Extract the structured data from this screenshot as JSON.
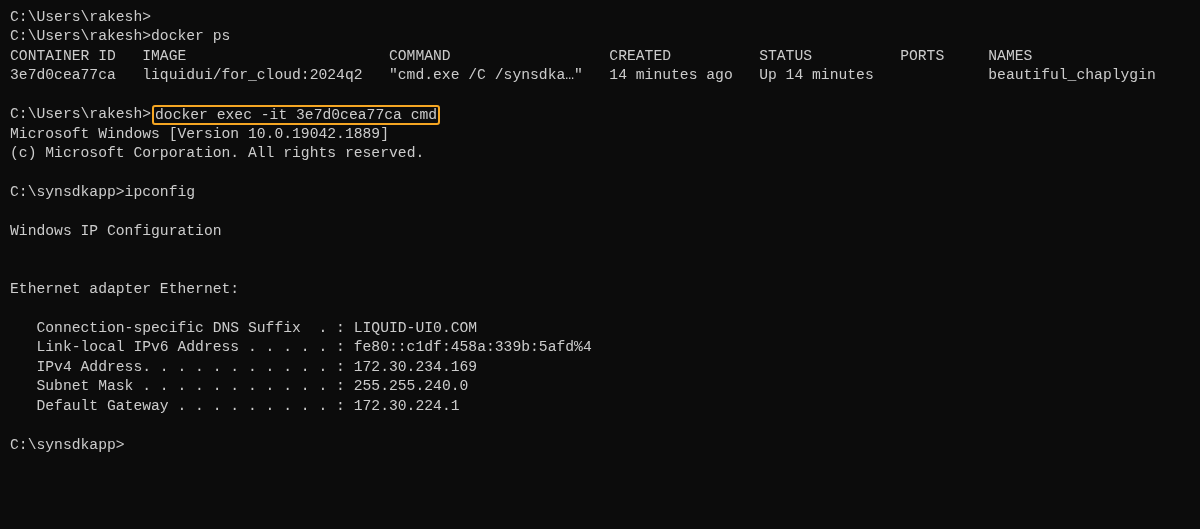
{
  "terminal": {
    "lines": [
      {
        "kind": "output",
        "text": "C:\\Users\\rakesh>"
      },
      {
        "kind": "output",
        "text": "C:\\Users\\rakesh>docker ps"
      },
      {
        "kind": "table",
        "columns": [
          "CONTAINER ID",
          "IMAGE",
          "COMMAND",
          "CREATED",
          "STATUS",
          "PORTS",
          "NAMES"
        ],
        "rows": [
          [
            "3e7d0cea77ca",
            "liquidui/for_cloud:2024q2",
            "\"cmd.exe /C /synsdka…\"",
            "14 minutes ago",
            "Up 14 minutes",
            null,
            "beautiful_chaplygin"
          ]
        ]
      },
      {
        "kind": "blank"
      },
      {
        "kind": "command",
        "prompt": "C:\\Users\\rakesh>",
        "command": "docker exec -it 3e7d0cea77ca cmd",
        "highlighted": true
      },
      {
        "kind": "output",
        "text": "Microsoft Windows [Version 10.0.19042.1889]"
      },
      {
        "kind": "output",
        "text": "(c) Microsoft Corporation. All rights reserved."
      },
      {
        "kind": "blank"
      },
      {
        "kind": "output",
        "text": "C:\\synsdkapp>ipconfig"
      },
      {
        "kind": "blank"
      },
      {
        "kind": "output",
        "text": "Windows IP Configuration"
      },
      {
        "kind": "blank"
      },
      {
        "kind": "blank"
      },
      {
        "kind": "output",
        "text": "Ethernet adapter Ethernet:"
      },
      {
        "kind": "blank"
      },
      {
        "kind": "detail",
        "text": "Connection-specific DNS Suffix  . : LIQUID-UI0.COM"
      },
      {
        "kind": "detail",
        "text": "Link-local IPv6 Address . . . . . : fe80::c1df:458a:339b:5afd%4"
      },
      {
        "kind": "detail",
        "text": "IPv4 Address. . . . . . . . . . . : 172.30.234.169"
      },
      {
        "kind": "detail",
        "text": "Subnet Mask . . . . . . . . . . . : 255.255.240.0"
      },
      {
        "kind": "detail",
        "text": "Default Gateway . . . . . . . . . : 172.30.224.1"
      },
      {
        "kind": "blank"
      },
      {
        "kind": "output",
        "text": "C:\\synsdkapp>"
      }
    ]
  }
}
